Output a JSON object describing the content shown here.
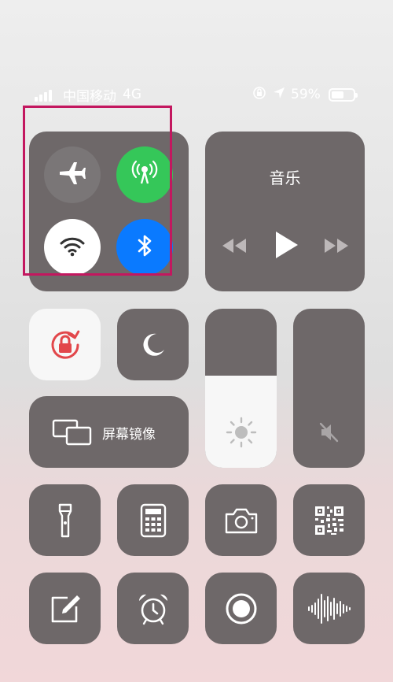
{
  "status_bar": {
    "carrier": "中国移动",
    "network": "4G",
    "battery_percent": "59%",
    "battery_level": 0.59
  },
  "music": {
    "title": "音乐"
  },
  "screen_mirroring": {
    "label": "屏幕镜像"
  },
  "sliders": {
    "brightness_level": 0.58,
    "volume_level": 0.0
  },
  "colors": {
    "tile": "#6e6869",
    "airplane_off": "#7a7677",
    "cellular_on": "#35c759",
    "wifi_on": "#ffffff",
    "bluetooth_on": "#0a7aff",
    "lock_red": "#e2474b",
    "highlight": "#c3175f"
  },
  "icons": [
    "airplane-icon",
    "cellular-icon",
    "wifi-icon",
    "bluetooth-icon",
    "rotation-lock-icon",
    "moon-icon",
    "screen-mirror-icon",
    "sun-icon",
    "mute-icon",
    "flashlight-icon",
    "calculator-icon",
    "camera-icon",
    "qr-code-icon",
    "notes-icon",
    "alarm-icon",
    "screen-record-icon",
    "voice-memo-icon",
    "rewind-icon",
    "play-icon",
    "fast-forward-icon",
    "location-icon",
    "orientation-icon"
  ]
}
